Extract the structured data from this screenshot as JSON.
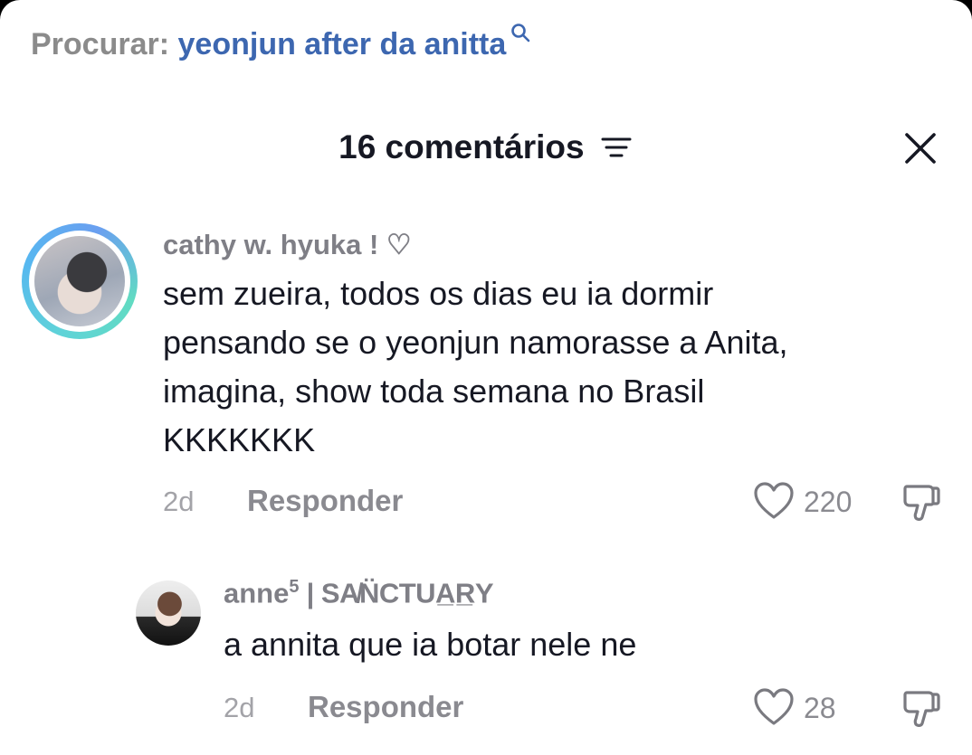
{
  "search": {
    "prefix": "Procurar:",
    "query": "yeonjun after da anitta",
    "icon": "search-icon"
  },
  "header": {
    "title": "16 comentários",
    "filter_icon": "filter-icon",
    "close_icon": "close-icon"
  },
  "comments": [
    {
      "username": "cathy w. hyuka ! ♡",
      "text_lines": [
        "sem zueira, todos os dias eu ia dormir",
        "pensando se o yeonjun namorasse a Anita,",
        "imagina, show toda semana no Brasil",
        "KKKKKKK"
      ],
      "time": "2d",
      "reply_label": "Responder",
      "likes": "220",
      "avatar_ring_colors": [
        "#5fd3d8",
        "#57b7f0",
        "#61dbc2"
      ]
    }
  ],
  "replies": [
    {
      "username_prefix": "anne",
      "username_sup": "5",
      "username_suffix": " | SA̸N̈CTUA̲R̲Y",
      "text": "a annita que ia botar nele ne",
      "time": "2d",
      "reply_label": "Responder",
      "likes": "28"
    }
  ],
  "colors": {
    "query": "#3d67b0",
    "text": "#161823",
    "muted": "#8a8a90"
  }
}
